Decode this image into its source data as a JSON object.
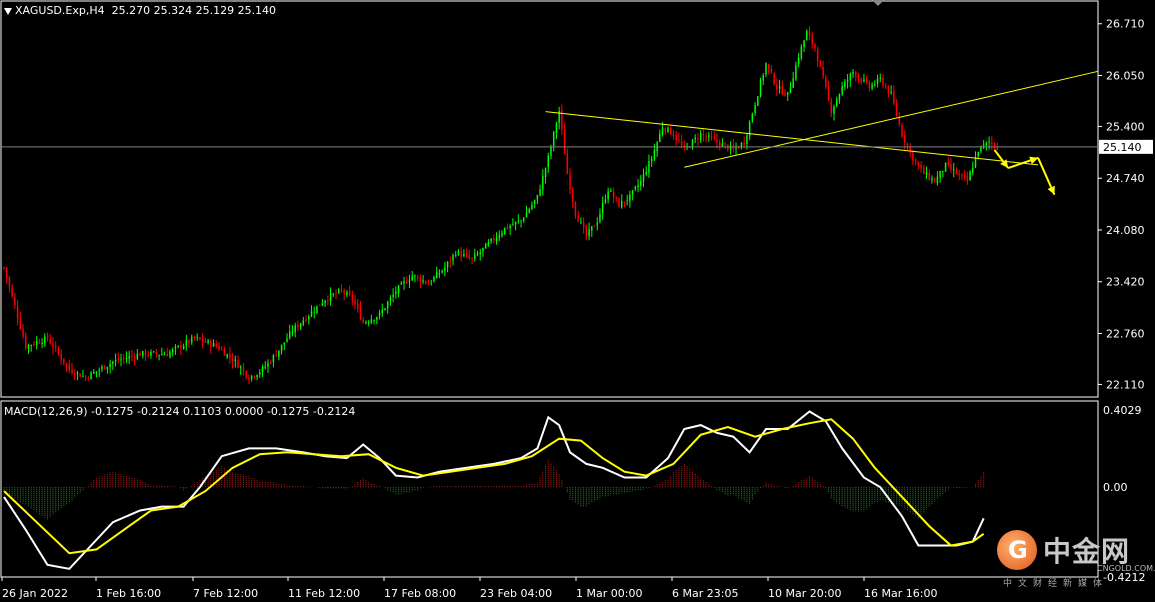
{
  "header": {
    "symbol": "XAGUSD.Exp,H4",
    "ohlc": "25.270 25.324 25.129 25.140"
  },
  "macd": {
    "label": "MACD(12,26,9) -0.1275 -0.2124 0.1103 0.0000 -0.1275 -0.2124",
    "axis_ticks": [
      "0.4029",
      "0.00",
      "-0.4212"
    ],
    "colors": {
      "positive": "#b22222",
      "negative": "#228b22",
      "line1": "#ffffff",
      "line2": "#ffff00"
    }
  },
  "current_price": "25.140",
  "logo": {
    "icon_char": "G",
    "name": "中金网",
    "site": "CNGOLD.COM.CN",
    "tagline": "中文财经新媒体"
  },
  "chart_data": {
    "type": "candlestick",
    "symbol": "XAGUSD",
    "timeframe": "H4",
    "y_ticks": [
      26.71,
      26.05,
      25.4,
      24.74,
      24.08,
      23.42,
      22.76,
      22.11
    ],
    "ylim": [
      21.95,
      27.0
    ],
    "x_tick_labels": [
      "26 Jan 2022",
      "1 Feb 16:00",
      "7 Feb 12:00",
      "11 Feb 12:00",
      "17 Feb 08:00",
      "23 Feb 04:00",
      "1 Mar 00:00",
      "6 Mar 23:05",
      "10 Mar 20:00",
      "16 Mar 16:00"
    ],
    "current_price": 25.14,
    "colors": {
      "up": "#00ff00",
      "down": "#ff0000",
      "trendline": "#ffff00",
      "arrow": "#ffff00"
    },
    "close_path": [
      [
        0,
        23.6
      ],
      [
        8,
        22.6
      ],
      [
        16,
        22.7
      ],
      [
        24,
        22.3
      ],
      [
        30,
        22.2
      ],
      [
        40,
        22.4
      ],
      [
        50,
        22.5
      ],
      [
        60,
        22.5
      ],
      [
        70,
        22.7
      ],
      [
        78,
        22.6
      ],
      [
        85,
        22.4
      ],
      [
        90,
        22.2
      ],
      [
        95,
        22.3
      ],
      [
        100,
        22.5
      ],
      [
        106,
        22.8
      ],
      [
        112,
        23.0
      ],
      [
        118,
        23.2
      ],
      [
        124,
        23.3
      ],
      [
        128,
        23.2
      ],
      [
        132,
        22.9
      ],
      [
        138,
        23.0
      ],
      [
        144,
        23.3
      ],
      [
        150,
        23.5
      ],
      [
        156,
        23.4
      ],
      [
        162,
        23.6
      ],
      [
        166,
        23.8
      ],
      [
        172,
        23.7
      ],
      [
        178,
        23.9
      ],
      [
        184,
        24.1
      ],
      [
        190,
        24.2
      ],
      [
        196,
        24.5
      ],
      [
        200,
        25.0
      ],
      [
        204,
        25.6
      ],
      [
        207,
        24.8
      ],
      [
        210,
        24.3
      ],
      [
        214,
        24.0
      ],
      [
        218,
        24.2
      ],
      [
        222,
        24.6
      ],
      [
        226,
        24.4
      ],
      [
        230,
        24.5
      ],
      [
        234,
        24.7
      ],
      [
        238,
        25.0
      ],
      [
        242,
        25.4
      ],
      [
        246,
        25.3
      ],
      [
        250,
        25.1
      ],
      [
        256,
        25.3
      ],
      [
        262,
        25.2
      ],
      [
        268,
        25.1
      ],
      [
        272,
        25.2
      ],
      [
        276,
        25.7
      ],
      [
        280,
        26.2
      ],
      [
        284,
        25.9
      ],
      [
        288,
        25.8
      ],
      [
        292,
        26.3
      ],
      [
        295,
        26.6
      ],
      [
        298,
        26.4
      ],
      [
        301,
        26.0
      ],
      [
        304,
        25.6
      ],
      [
        308,
        25.9
      ],
      [
        312,
        26.1
      ],
      [
        318,
        25.9
      ],
      [
        322,
        26.0
      ],
      [
        326,
        25.8
      ],
      [
        330,
        25.3
      ],
      [
        334,
        25.0
      ],
      [
        338,
        24.8
      ],
      [
        342,
        24.7
      ],
      [
        346,
        24.9
      ],
      [
        350,
        24.8
      ],
      [
        354,
        24.7
      ],
      [
        358,
        25.1
      ],
      [
        362,
        25.2
      ],
      [
        365,
        25.14
      ]
    ],
    "trendlines": [
      {
        "from": [
          199,
          25.59
        ],
        "to": [
          380,
          24.91
        ]
      },
      {
        "from": [
          250,
          24.88
        ],
        "to": [
          460,
          26.57
        ]
      }
    ],
    "arrows": [
      {
        "from": [
          364,
          25.1
        ],
        "to": [
          369,
          24.87
        ]
      },
      {
        "from": [
          369,
          24.87
        ],
        "to": [
          380,
          25.0
        ]
      },
      {
        "from": [
          380,
          25.0
        ],
        "to": [
          386,
          24.53
        ]
      }
    ],
    "macd": {
      "ylim": [
        -0.4212,
        0.4029
      ],
      "main_line_path": [
        [
          0,
          -0.05
        ],
        [
          8,
          -0.22
        ],
        [
          16,
          -0.4
        ],
        [
          24,
          -0.42
        ],
        [
          32,
          -0.3
        ],
        [
          40,
          -0.18
        ],
        [
          50,
          -0.12
        ],
        [
          58,
          -0.1
        ],
        [
          66,
          -0.1
        ],
        [
          72,
          0.0
        ],
        [
          80,
          0.16
        ],
        [
          90,
          0.2
        ],
        [
          100,
          0.2
        ],
        [
          110,
          0.18
        ],
        [
          118,
          0.16
        ],
        [
          126,
          0.15
        ],
        [
          132,
          0.22
        ],
        [
          138,
          0.15
        ],
        [
          144,
          0.06
        ],
        [
          152,
          0.05
        ],
        [
          160,
          0.08
        ],
        [
          170,
          0.1
        ],
        [
          180,
          0.12
        ],
        [
          190,
          0.15
        ],
        [
          196,
          0.2
        ],
        [
          200,
          0.36
        ],
        [
          204,
          0.32
        ],
        [
          208,
          0.18
        ],
        [
          214,
          0.12
        ],
        [
          220,
          0.1
        ],
        [
          228,
          0.05
        ],
        [
          236,
          0.05
        ],
        [
          244,
          0.15
        ],
        [
          250,
          0.3
        ],
        [
          256,
          0.32
        ],
        [
          262,
          0.28
        ],
        [
          268,
          0.26
        ],
        [
          274,
          0.18
        ],
        [
          280,
          0.3
        ],
        [
          288,
          0.3
        ],
        [
          296,
          0.39
        ],
        [
          302,
          0.34
        ],
        [
          308,
          0.2
        ],
        [
          316,
          0.05
        ],
        [
          322,
          0.0
        ],
        [
          330,
          -0.15
        ],
        [
          336,
          -0.3
        ],
        [
          342,
          -0.3
        ],
        [
          350,
          -0.3
        ],
        [
          356,
          -0.28
        ],
        [
          360,
          -0.16
        ]
      ],
      "signal_line_path": [
        [
          0,
          -0.02
        ],
        [
          12,
          -0.18
        ],
        [
          24,
          -0.34
        ],
        [
          34,
          -0.32
        ],
        [
          44,
          -0.22
        ],
        [
          54,
          -0.12
        ],
        [
          64,
          -0.1
        ],
        [
          74,
          -0.02
        ],
        [
          84,
          0.1
        ],
        [
          94,
          0.17
        ],
        [
          104,
          0.18
        ],
        [
          114,
          0.17
        ],
        [
          124,
          0.16
        ],
        [
          134,
          0.17
        ],
        [
          144,
          0.1
        ],
        [
          154,
          0.06
        ],
        [
          164,
          0.08
        ],
        [
          174,
          0.1
        ],
        [
          184,
          0.12
        ],
        [
          194,
          0.16
        ],
        [
          204,
          0.25
        ],
        [
          212,
          0.24
        ],
        [
          220,
          0.15
        ],
        [
          228,
          0.08
        ],
        [
          236,
          0.06
        ],
        [
          246,
          0.12
        ],
        [
          256,
          0.27
        ],
        [
          266,
          0.31
        ],
        [
          276,
          0.26
        ],
        [
          286,
          0.3
        ],
        [
          296,
          0.33
        ],
        [
          304,
          0.35
        ],
        [
          312,
          0.25
        ],
        [
          320,
          0.1
        ],
        [
          330,
          -0.05
        ],
        [
          340,
          -0.2
        ],
        [
          348,
          -0.3
        ],
        [
          356,
          -0.28
        ],
        [
          360,
          -0.24
        ]
      ]
    }
  }
}
